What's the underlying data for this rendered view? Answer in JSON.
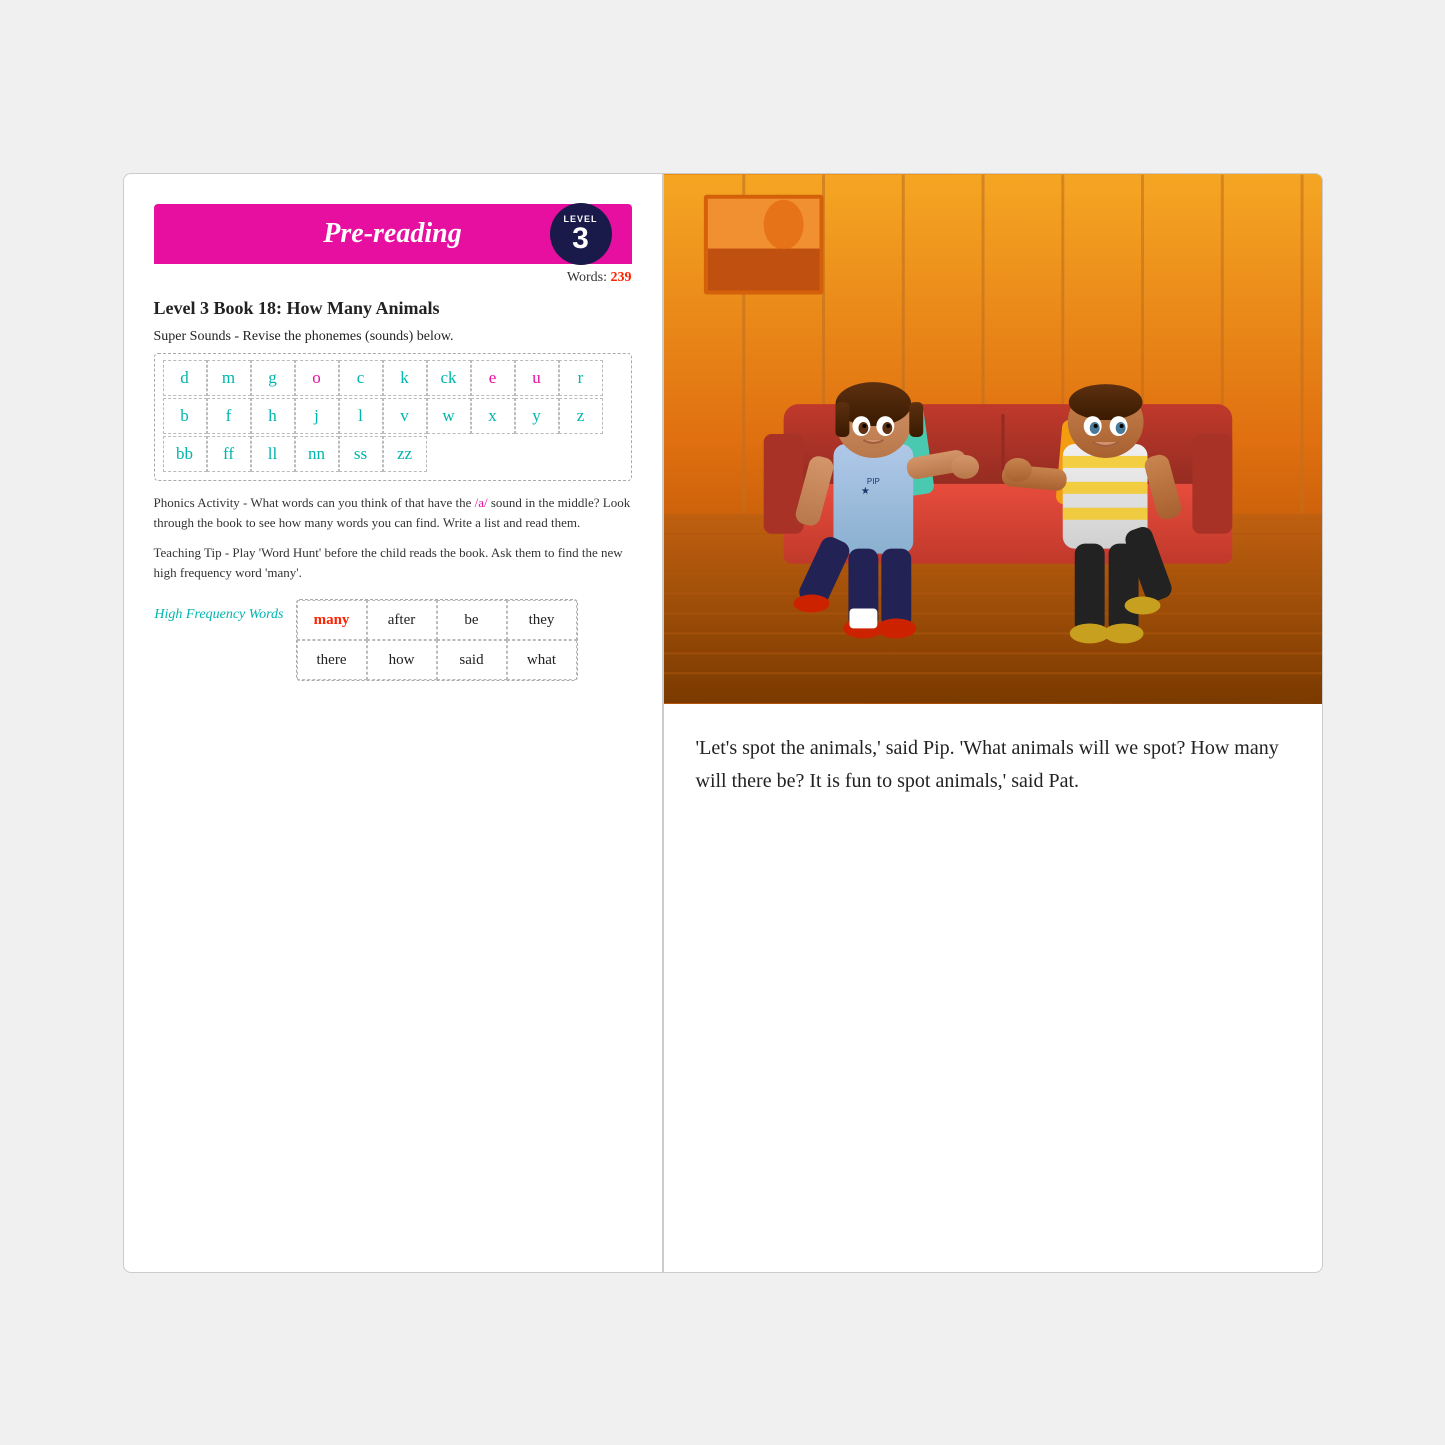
{
  "left_page": {
    "header": {
      "title": "Pre-reading",
      "level_label": "LEVEL",
      "level_number": "3"
    },
    "words_label": "Words:",
    "words_count": "239",
    "book_title": "Level 3 Book 18: How Many Animals",
    "super_sounds_label": "Super Sounds - Revise the phonemes (sounds) below.",
    "phoneme_rows": [
      [
        {
          "letter": "d",
          "color": "teal"
        },
        {
          "letter": "m",
          "color": "teal"
        },
        {
          "letter": "g",
          "color": "teal"
        },
        {
          "letter": "o",
          "color": "magenta"
        },
        {
          "letter": "c",
          "color": "teal"
        },
        {
          "letter": "k",
          "color": "teal"
        },
        {
          "letter": "ck",
          "color": "teal"
        },
        {
          "letter": "e",
          "color": "magenta"
        },
        {
          "letter": "u",
          "color": "magenta"
        },
        {
          "letter": "r",
          "color": "teal"
        }
      ],
      [
        {
          "letter": "b",
          "color": "teal"
        },
        {
          "letter": "f",
          "color": "teal"
        },
        {
          "letter": "h",
          "color": "teal"
        },
        {
          "letter": "j",
          "color": "teal"
        },
        {
          "letter": "l",
          "color": "teal"
        },
        {
          "letter": "v",
          "color": "teal"
        },
        {
          "letter": "w",
          "color": "teal"
        },
        {
          "letter": "x",
          "color": "teal"
        },
        {
          "letter": "y",
          "color": "teal"
        },
        {
          "letter": "z",
          "color": "teal"
        }
      ],
      [
        {
          "letter": "bb",
          "color": "teal"
        },
        {
          "letter": "ff",
          "color": "teal"
        },
        {
          "letter": "ll",
          "color": "teal"
        },
        {
          "letter": "nn",
          "color": "teal"
        },
        {
          "letter": "ss",
          "color": "teal"
        },
        {
          "letter": "zz",
          "color": "teal"
        }
      ]
    ],
    "phonics_activity": "Phonics Activity - What words can you think of that have the /a/ sound in the middle? Look through the book to see how many words you can find. Write a list and read them.",
    "phonics_highlight": "/a/",
    "teaching_tip": "Teaching Tip - Play 'Word Hunt' before the child reads the book. Ask them to find the new high frequency word 'many'.",
    "hfw_label": "High Frequency Words",
    "hfw_rows": [
      [
        {
          "word": "many",
          "color": "red"
        },
        {
          "word": "after",
          "color": "black"
        },
        {
          "word": "be",
          "color": "black"
        },
        {
          "word": "they",
          "color": "black"
        }
      ],
      [
        {
          "word": "there",
          "color": "black"
        },
        {
          "word": "how",
          "color": "black"
        },
        {
          "word": "said",
          "color": "black"
        },
        {
          "word": "what",
          "color": "black"
        }
      ]
    ]
  },
  "right_page": {
    "story_text": "'Let's spot the animals,' said Pip. 'What animals will we spot? How many will there be? It is fun to spot animals,' said Pat."
  }
}
